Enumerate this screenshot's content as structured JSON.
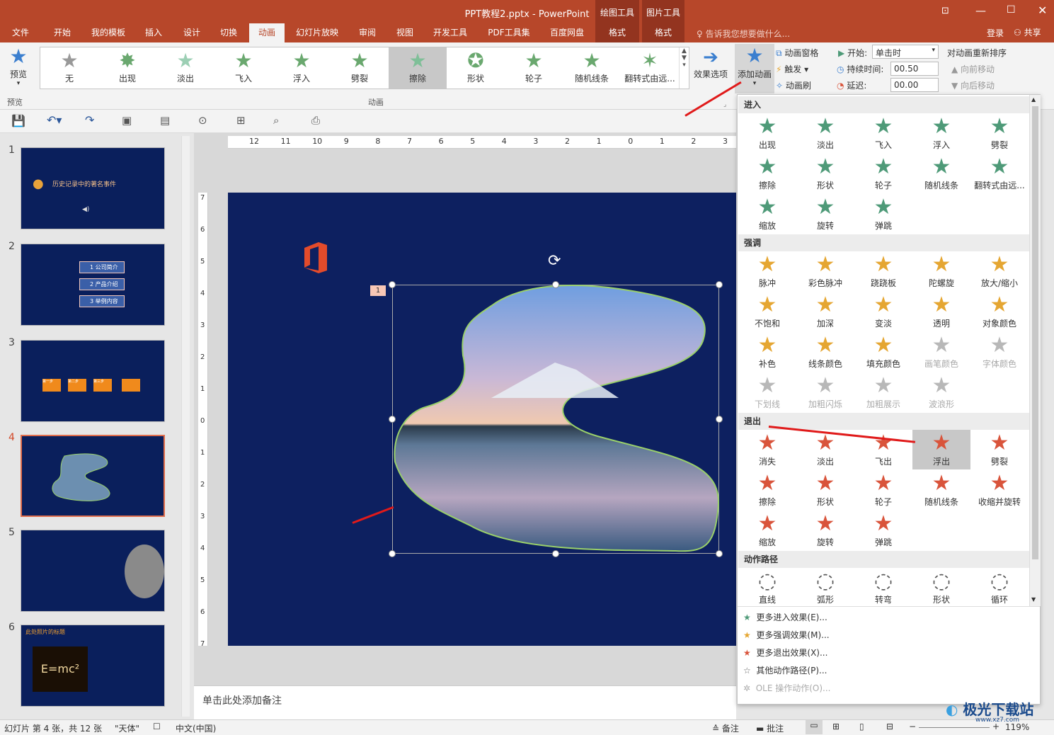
{
  "app": {
    "title": "PPT教程2.pptx - PowerPoint",
    "context_groups": [
      "绘图工具",
      "图片工具"
    ],
    "login": "登录",
    "share": "共享",
    "tell_me": "告诉我您想要做什么..."
  },
  "tabs": [
    "文件",
    "开始",
    "我的模板",
    "插入",
    "设计",
    "切换",
    "动画",
    "幻灯片放映",
    "审阅",
    "视图",
    "开发工具",
    "PDF工具集",
    "百度网盘",
    "格式",
    "格式"
  ],
  "ribbon": {
    "preview": "预览",
    "preview_group": "预览",
    "animations": [
      "无",
      "出现",
      "淡出",
      "飞入",
      "浮入",
      "劈裂",
      "擦除",
      "形状",
      "轮子",
      "随机线条",
      "翻转式由远..."
    ],
    "selected_animation": "擦除",
    "animation_group": "动画",
    "effect_options": "效果选项",
    "add_animation": "添加动画",
    "anim_pane": "动画窗格",
    "trigger": "触发",
    "anim_painter": "动画刷",
    "start_label": "开始:",
    "start_value": "单击时",
    "duration_label": "持续时间:",
    "duration_value": "00.50",
    "delay_label": "延迟:",
    "delay_value": "00.00",
    "reorder": "对动画重新排序",
    "move_earlier": "向前移动",
    "move_later": "向后移动"
  },
  "ruler": {
    "h_ticks": [
      "12",
      "11",
      "10",
      "9",
      "8",
      "7",
      "6",
      "5",
      "4",
      "3",
      "2",
      "1",
      "0",
      "1",
      "2",
      "3"
    ],
    "v_ticks": [
      "7",
      "6",
      "5",
      "4",
      "3",
      "2",
      "1",
      "0",
      "1",
      "2",
      "3",
      "4",
      "5",
      "6",
      "7"
    ]
  },
  "slides": [
    {
      "num": "1",
      "text": "历史记录中的著名事件"
    },
    {
      "num": "2",
      "items": [
        "1 公司简介",
        "2 产品介绍",
        "3 举例内容"
      ]
    },
    {
      "num": "3",
      "steps": [
        "第一步",
        "第二步",
        "第三步",
        ""
      ]
    },
    {
      "num": "4"
    },
    {
      "num": "5"
    },
    {
      "num": "6",
      "text": "此处照片的标题",
      "formula": "E=mc²"
    }
  ],
  "selected_slide": "4",
  "anim_tag": "1",
  "notes_placeholder": "单击此处添加备注",
  "dropdown": {
    "sections": [
      {
        "title": "进入",
        "class": "enter",
        "items": [
          "出现",
          "淡出",
          "飞入",
          "浮入",
          "劈裂",
          "擦除",
          "形状",
          "轮子",
          "随机线条",
          "翻转式由远...",
          "缩放",
          "旋转",
          "弹跳"
        ]
      },
      {
        "title": "强调",
        "class": "emph",
        "items": [
          "脉冲",
          "彩色脉冲",
          "跷跷板",
          "陀螺旋",
          "放大/缩小",
          "不饱和",
          "加深",
          "变淡",
          "透明",
          "对象颜色",
          "补色",
          "线条颜色",
          "填充颜色",
          "画笔颜色",
          "字体颜色",
          "下划线",
          "加粗闪烁",
          "加粗展示",
          "波浪形"
        ]
      },
      {
        "title": "退出",
        "class": "exit",
        "items": [
          "消失",
          "淡出",
          "飞出",
          "浮出",
          "劈裂",
          "擦除",
          "形状",
          "轮子",
          "随机线条",
          "收缩并旋转",
          "缩放",
          "旋转",
          "弹跳"
        ]
      },
      {
        "title": "动作路径",
        "class": "path",
        "items": [
          "直线",
          "弧形",
          "转弯",
          "形状",
          "循环"
        ]
      }
    ],
    "highlighted": "浮出",
    "more": [
      "更多进入效果(E)...",
      "更多强调效果(M)...",
      "更多退出效果(X)...",
      "其他动作路径(P)...",
      "OLE 操作动作(O)..."
    ]
  },
  "status": {
    "slide_info": "幻灯片 第 4 张，共 12 张",
    "theme": "\"天体\"",
    "language": "中文(中国)",
    "notes": "备注",
    "comments": "批注",
    "zoom": "119%"
  },
  "watermark": "极光下载站",
  "watermark_url": "www.xz7.com"
}
